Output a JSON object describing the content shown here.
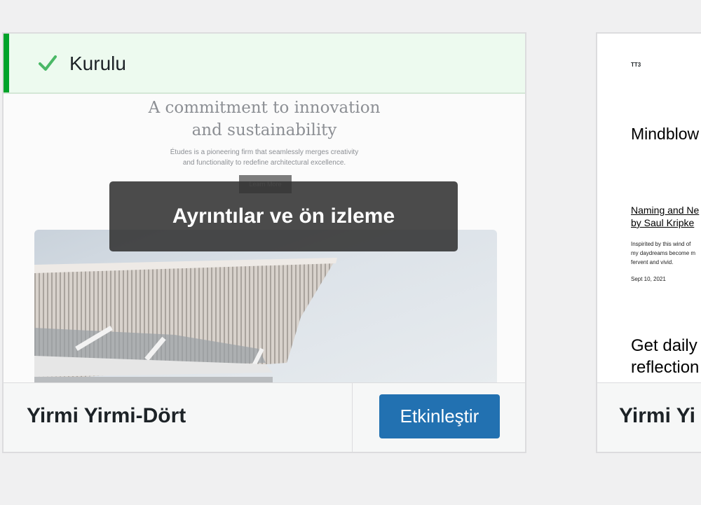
{
  "installed_notice": {
    "label": "Kurulu",
    "icon": "checkmark-icon",
    "accent": "#00a32a"
  },
  "theme1": {
    "preview": {
      "title_line1": "A commitment to innovation",
      "title_line2": "and sustainability",
      "subtitle_line1": "Études is a pioneering firm that seamlessly merges creativity",
      "subtitle_line2": "and functionality to redefine architectural excellence.",
      "button": "Learn More"
    },
    "overlay_label": "Ayrıntılar ve ön izleme",
    "name": "Yirmi Yirmi-Dört",
    "activate_label": "Etkinleştir",
    "activate_color": "#2271b1"
  },
  "theme2": {
    "preview": {
      "logo": "TT3",
      "heading": "Mindblow",
      "post_title_line1": "Naming and Ne",
      "post_title_line2": "by Saul Kripke",
      "excerpt_line1": "Inspirited by this wind of",
      "excerpt_line2": "my daydreams become m",
      "excerpt_line3": "fervent and vivid.",
      "date": "Sept 10, 2021",
      "big_line1": "Get daily",
      "big_line2": "reflection"
    },
    "name": "Yirmi Yi"
  }
}
